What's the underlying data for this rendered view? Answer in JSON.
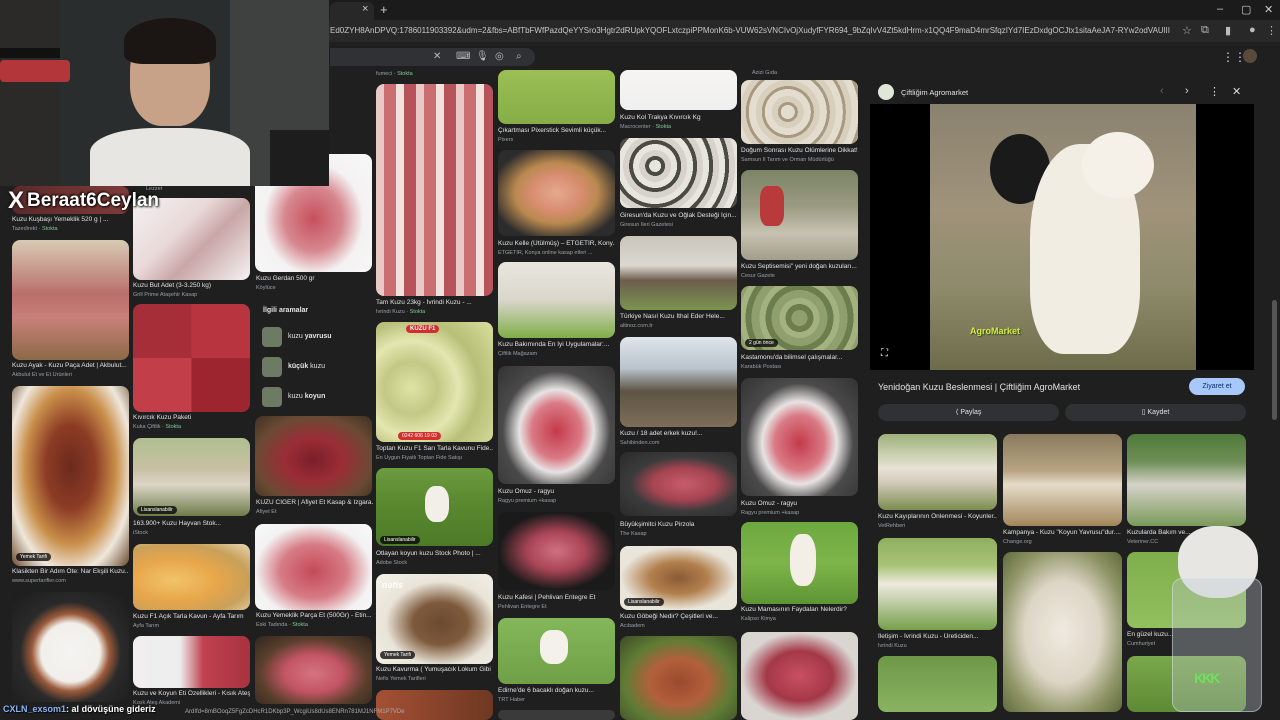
{
  "browser": {
    "url": "Ed0ZYH8AnDPVQ:1786011903392&udm=2&fbs=ABfTbFWfPazdQeYYSro3Hgtr2dRUpkYQOFLxtczpiPPMonK6b-VUW62sVNCIvOjXudyfFYR694_9bZqIvV4Zt5kdHrm-x1QQ4F9maD4mrSfqzIYd7IEzDxdgOCJtx1sitaAeJA7-RYw2odVAUlIInCo23ljKbBGFpsB0rAJRzK_Y4z1qgAlHEyIt...",
    "new_tab": "+",
    "tab_close": "×"
  },
  "overlay": {
    "x_logo": "X",
    "handle": "Beraat6Ceylan",
    "ticker_user": "CXLN_exsom1",
    "ticker_colon": ":",
    "ticker_al": "al",
    "ticker_msg": "dövüşüne gideriz",
    "bottom_url": "ArdIfd=8mBOoqZ5FgZcDHcR1DKbp3P_WcgiUs8dUs8ENRn781MJ1NFM1P7VDe"
  },
  "grid": {
    "col1": [
      {
        "caption": "Kuzu Kuşbaşı Yemeklik 520 g | ...",
        "source": "Tazedirekt",
        "stock": "· Stokta"
      },
      {
        "caption": "Kuzu Ayak - Kuzu Paça Adet | Akbulut...",
        "source": "Akbulut Et ve Et Ürünleri",
        "stock": ""
      },
      {
        "caption": "Klasikten Bir Adım Öte: Nar Ekşili Kuzu...",
        "source": "www.supertarifler.com",
        "stock": "",
        "badge": "Yemek Tarifi"
      },
      {
        "caption": "",
        "source": "",
        "stock": ""
      }
    ],
    "col2": [
      {
        "caption": "Kuzu But Adet (3-3.250 kg)",
        "source": "Grill Prime Ataşehir Kasap",
        "stock": "",
        "top_label": "Lezzet"
      },
      {
        "caption": "Kıvırcık Kuzu Paketi",
        "source": "Kuka Çiftlik",
        "stock": "· Stokta"
      },
      {
        "caption": "163.900+ Kuzu Hayvan Stok...",
        "source": "iStock",
        "stock": "",
        "badge": "Lisanslanabilir"
      },
      {
        "caption": "Kuzu F1 Açık Tarla Kavun - Ayfa Tarım",
        "source": "Ayfa Tarım",
        "stock": ""
      },
      {
        "caption": "Kuzu ve Koyun Eti Özellikleri - Kısık Ateş",
        "source": "Kısık Ateş Akademi",
        "stock": ""
      }
    ],
    "col3": [
      {
        "caption": "Kuzu Gerdan 500 gr",
        "source": "Köylüce",
        "stock": ""
      },
      {
        "caption": "KUZU CİĞER | Afiyet Et Kasap & Izgara...",
        "source": "Afiyet Et",
        "stock": ""
      },
      {
        "caption": "Kuzu Yemeklik Parça Et (500Gr) - Etin...",
        "source": "Eski Tadında",
        "stock": "· Stokta"
      },
      {
        "caption": "",
        "source": "",
        "stock": ""
      }
    ],
    "col4": [
      {
        "caption": "",
        "source": "fumeci",
        "stock": "· Stokta"
      },
      {
        "caption": "Tam Kuzu 23kg - İvrindi Kuzu - ...",
        "source": "İvrindi Kuzu",
        "stock": "· Stokta"
      },
      {
        "caption": "Toptan Kuzu F1 Sarı Tarla Kavunu Fide...",
        "source": "En Uygun Fiyatlı Toptan Fide Satışı",
        "stock": "",
        "label": "KUZU F1",
        "phone": "0242 606 19 03"
      },
      {
        "caption": "Otlayan koyun kuzu Stock Photo | ...",
        "source": "Adobe Stock",
        "stock": "",
        "badge": "Lisanslanabilir"
      },
      {
        "caption": "Kuzu Kavurma ( Yumuşacık Lokum Gibi )",
        "source": "Nefis Yemek Tarifleri",
        "stock": "",
        "badge": "Yemek Tarifi",
        "label": "nefis"
      }
    ],
    "col5": [
      {
        "caption": "Çıkartması Pixerstick Sevimli küçük...",
        "source": "Pixers",
        "stock": ""
      },
      {
        "caption": "Kuzu Kelle (Ütülmüş) – ETGETİR, Kony...",
        "source": "ETGETİR, Konya online kasap etleri ...",
        "stock": ""
      },
      {
        "caption": "Kuzu Bakımında En İyi Uygulamalar:...",
        "source": "Çiftlik Mağazam",
        "stock": ""
      },
      {
        "caption": "Kuzu Omuz - ragyu",
        "source": "Ragyu premium +kasap",
        "stock": ""
      },
      {
        "caption": "Kuzu Kafesi | Pehlivan Entegre Et",
        "source": "Pehlivan Entegre Et",
        "stock": ""
      },
      {
        "caption": "Edirne'de 6 bacaklı doğan kuzu...",
        "source": "TRT Haber",
        "stock": ""
      }
    ],
    "col6": [
      {
        "caption": "Kuzu Kol Trakya Kıvırcık Kg",
        "source": "Macrocenter",
        "stock": "· Stokta"
      },
      {
        "caption": "Giresun'da Kuzu ve Oğlak Desteği İçin...",
        "source": "Giresun İleri Gazetesi",
        "stock": ""
      },
      {
        "caption": "Türkiye Nasıl Kuzu İthal Eder Hele...",
        "source": "altinoz.com.tr",
        "stock": ""
      },
      {
        "caption": "Kuzu / 18 adet erkek kuzu!...",
        "source": "Sahibinden.com",
        "stock": ""
      },
      {
        "caption": "Büyükşimitci Kuzu Pirzola",
        "source": "The Kasap",
        "stock": ""
      },
      {
        "caption": "Kuzu Göbeği Nedir? Çeşitleri ve...",
        "source": "Acıbadem",
        "stock": "",
        "badge": "Lisanslanabilir"
      },
      {
        "caption": "",
        "source": "",
        "stock": ""
      }
    ],
    "col7": [
      {
        "caption": "",
        "source": "Azizi Gıda",
        "stock": ""
      },
      {
        "caption": "Doğum Sonrası Kuzu Ölümlerine Dikkat!",
        "source": "Samsun İl Tarım ve Orman Müdürlüğü",
        "stock": ""
      },
      {
        "caption": "Kuzu Septisemisi\" yeni doğan kuzuları...",
        "source": "Cesur Gazete",
        "stock": ""
      },
      {
        "caption": "Kastamonu'da bilimsel çalışmalar...",
        "source": "Karabük Postası",
        "stock": "",
        "badge": "2 gün önce"
      },
      {
        "caption": "Kuzu Omuz - ragyu",
        "source": "Ragyu premium +kasap",
        "stock": ""
      },
      {
        "caption": "Kuzu Mamasının Faydaları Nelerdir?",
        "source": "Kalipso Kimya",
        "stock": ""
      },
      {
        "caption": "",
        "source": "",
        "stock": ""
      }
    ]
  },
  "related": {
    "title": "İlgili aramalar",
    "items": [
      {
        "prefix": "kuzu ",
        "bold": "yavrusu",
        "suffix": ""
      },
      {
        "prefix": "",
        "bold": "küçük",
        "suffix": " kuzu"
      },
      {
        "prefix": "kuzu ",
        "bold": "koyun",
        "suffix": ""
      }
    ]
  },
  "panel": {
    "site": "Çiftliğim Agromarket",
    "title": "Yenidoğan Kuzu Beslenmesi | Çiftliğim AgroMarket",
    "visit": "Ziyaret et",
    "share": "Paylaş",
    "save": "Kaydet",
    "watermark": "AgroMarket",
    "related": [
      {
        "caption": "Kuzu Kayıplarının Önlenmesi - Koyunler...",
        "source": "VetRehberi"
      },
      {
        "caption": "Kampanya - Kuzu \"Koyun Yavrusu\"dur....",
        "source": "Change.org"
      },
      {
        "caption": "Kuzularda Bakım ve...",
        "source": "Veteriner.CC"
      },
      {
        "caption": "İletişim - İvrindi Kuzu - Üreticiden...",
        "source": "İvrindi Kuzu"
      },
      {
        "caption": "",
        "source": ""
      },
      {
        "caption": "En güzel kuzu...",
        "source": "Cumhuriyet"
      }
    ]
  },
  "cat_sticker": {
    "text": "KKK"
  },
  "colors": {
    "accent": "#a8c7fa",
    "stock_green": "#81c995",
    "bg": "#1f1f1f"
  }
}
